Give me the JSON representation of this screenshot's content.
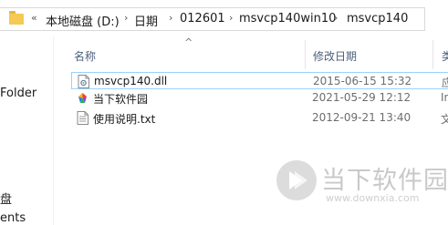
{
  "address": {
    "overflow_glyph": "«",
    "crumbs": [
      "本地磁盘 (D:)",
      "日期",
      "012601",
      "msvcp140win10",
      "msvcp140"
    ],
    "separator": "›"
  },
  "nav": {
    "items": [
      "Folder",
      "盘",
      "ents"
    ]
  },
  "columns": {
    "name": "名称",
    "date": "修改日期",
    "type": "类"
  },
  "files": [
    {
      "name": "msvcp140.dll",
      "date": "2015-06-15 15:32",
      "type": "应",
      "icon": "dll-file-icon",
      "selected": true
    },
    {
      "name": "当下软件园",
      "date": "2021-05-29 12:12",
      "type": "In",
      "icon": "internet-shortcut-icon",
      "selected": false
    },
    {
      "name": "使用说明.txt",
      "date": "2012-09-21 13:40",
      "type": "文",
      "icon": "text-file-icon",
      "selected": false
    }
  ],
  "watermark": {
    "brand": "当下软件园",
    "url": "www.downxia.com"
  }
}
